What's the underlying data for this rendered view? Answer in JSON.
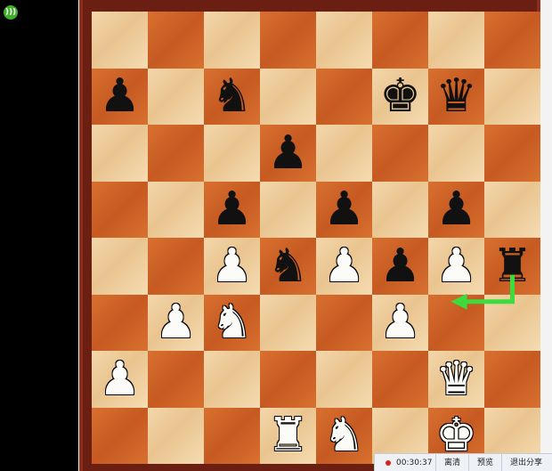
{
  "board": [
    [
      "",
      "",
      "",
      "",
      "",
      "",
      "",
      ""
    ],
    [
      "bp",
      "",
      "bn",
      "",
      "",
      "bk",
      "bq",
      ""
    ],
    [
      "",
      "",
      "",
      "bp",
      "",
      "",
      "",
      ""
    ],
    [
      "",
      "",
      "bp",
      "",
      "bp",
      "",
      "bp",
      ""
    ],
    [
      "",
      "",
      "wp",
      "bn",
      "wp",
      "bp",
      "wp",
      "br"
    ],
    [
      "",
      "wp",
      "wn",
      "",
      "",
      "wp",
      "",
      ""
    ],
    [
      "wp",
      "",
      "",
      "",
      "",
      "",
      "wq",
      ""
    ],
    [
      "",
      "",
      "",
      "wr",
      "wn",
      "",
      "wk",
      ""
    ]
  ],
  "glyphs": {
    "k": "♚",
    "q": "♛",
    "r": "♜",
    "b": "♝",
    "n": "♞",
    "p": "♟"
  },
  "arrow_color": "#3ddc3d",
  "arrow": {
    "from": "h4",
    "to": "g3"
  },
  "statusbar": {
    "timer": "00:30:37",
    "btn1": "离清",
    "btn2": "预览",
    "btn3": "退出分享"
  },
  "live_icon": "broadcast-icon"
}
